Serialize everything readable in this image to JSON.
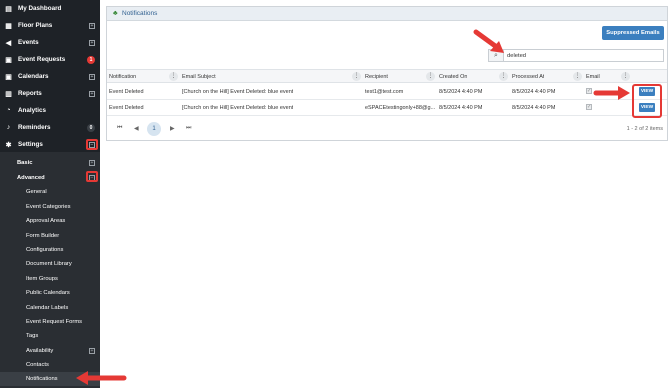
{
  "sidebar": {
    "items": [
      {
        "label": "My Dashboard",
        "icon": "dashboard-icon"
      },
      {
        "label": "Floor Plans",
        "icon": "floor-plan-icon",
        "expand": "+"
      },
      {
        "label": "Events",
        "icon": "megaphone-icon",
        "expand": "+"
      },
      {
        "label": "Event Requests",
        "icon": "calendar-request-icon",
        "badge": "1",
        "badge_color": "#e53935"
      },
      {
        "label": "Calendars",
        "icon": "calendar-icon",
        "expand": "+"
      },
      {
        "label": "Reports",
        "icon": "reports-icon",
        "expand": "+"
      },
      {
        "label": "Analytics",
        "icon": "analytics-icon"
      },
      {
        "label": "Reminders",
        "icon": "bell-icon",
        "badge": "0",
        "badge_color": "#3a3f45"
      },
      {
        "label": "Settings",
        "icon": "gear-icon",
        "expand": "−"
      }
    ],
    "settings_children": {
      "basic": {
        "label": "Basic",
        "expand": "+"
      },
      "advanced": {
        "label": "Advanced",
        "expand": "−"
      },
      "advanced_items": [
        "General",
        "Event Categories",
        "Approval Areas",
        "Form Builder",
        "Configurations",
        "Document Library",
        "Item Groups",
        "Public Calendars",
        "Calendar Labels",
        "Event Request Forms",
        "Tags",
        "Availability",
        "Contacts",
        "Notifications"
      ],
      "availability_expand": "+"
    }
  },
  "panel": {
    "title": "Notifications",
    "suppressed_button": "Suppressed Emails",
    "search_value": "deleted",
    "columns": [
      "Notification",
      "Email Subject",
      "Recipient",
      "Created On",
      "Processed At",
      "Email"
    ],
    "rows": [
      {
        "notification": "Event Deleted",
        "subject": "[Church on the Hill] Event Deleted: blue event",
        "recipient": "test1@test.com",
        "created": "8/5/2024 4:40 PM",
        "processed": "8/5/2024 4:40 PM",
        "email_checked": true,
        "action": "VIEW"
      },
      {
        "notification": "Event Deleted",
        "subject": "[Church on the Hill] Event Deleted: blue event",
        "recipient": "eSPACEtestingonly+88@g...",
        "created": "8/5/2024 4:40 PM",
        "processed": "8/5/2024 4:40 PM",
        "email_checked": true,
        "action": "VIEW"
      }
    ],
    "pager": {
      "first": "⏮",
      "prev": "◀",
      "current": "1",
      "next": "▶",
      "last": "⏭",
      "info": "1 - 2 of 2 items"
    }
  },
  "colors": {
    "accent": "#3b7fbf",
    "highlight": "#e53935",
    "sidebar": "#1e2227"
  }
}
